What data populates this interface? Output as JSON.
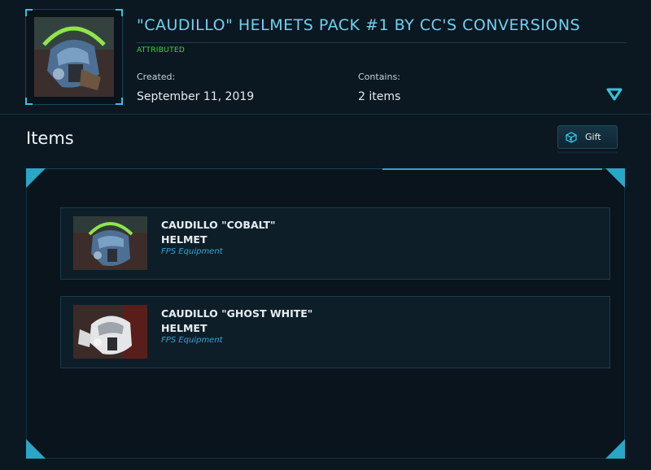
{
  "pack": {
    "title": "\"CAUDILLO\" HELMETS PACK #1 BY CC'S CONVERSIONS",
    "attribution": "ATTRIBUTED",
    "created_label": "Created:",
    "created_value": "September 11, 2019",
    "contains_label": "Contains:",
    "contains_value": "2 items",
    "thumbnail_icon": "helmet-image"
  },
  "items_section": {
    "heading": "Items",
    "gift_label": "Gift",
    "gift_icon": "gift-cube-icon"
  },
  "items": [
    {
      "name_line1": "CAUDILLO \"COBALT\"",
      "name_line2": "HELMET",
      "category": "FPS Equipment",
      "image": "cobalt-helmet-image"
    },
    {
      "name_line1": "CAUDILLO \"GHOST WHITE\"",
      "name_line2": "HELMET",
      "category": "FPS Equipment",
      "image": "ghost-white-helmet-image"
    }
  ],
  "colors": {
    "accent": "#35c3e0",
    "title": "#6fd2ee",
    "attributed": "#2fe02f",
    "category": "#2fa7d6",
    "background": "#0b1721"
  }
}
